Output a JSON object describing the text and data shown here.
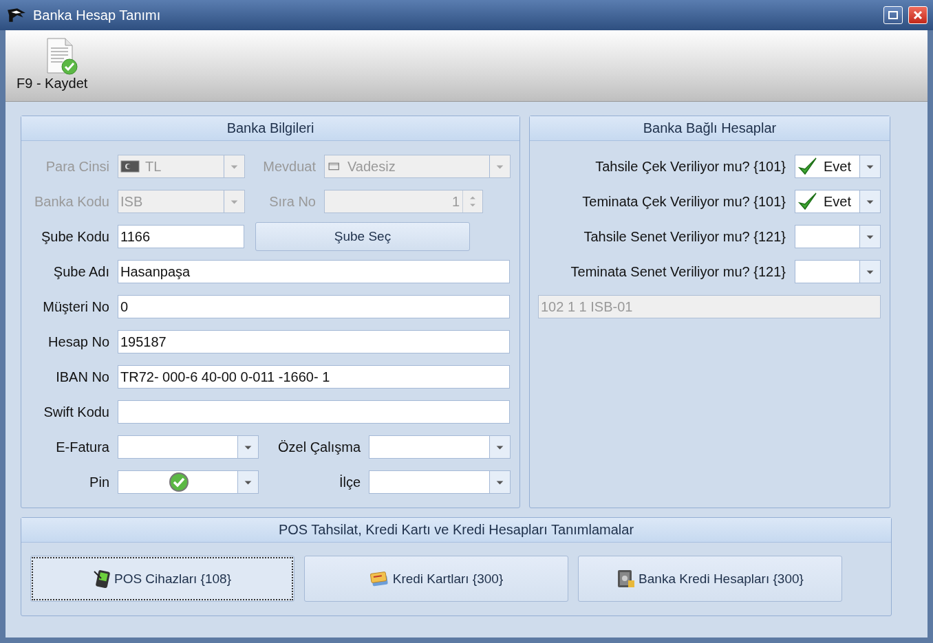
{
  "window": {
    "title": "Banka Hesap Tanımı"
  },
  "toolbar": [
    {
      "label": "F9 - Kaydet"
    }
  ],
  "bank_info": {
    "title": "Banka Bilgileri",
    "rows": [
      {
        "fields": [
          {
            "kind": "flag-combo",
            "label": "Para Cinsi",
            "value": "TL",
            "disabled": true
          },
          {
            "kind": "image-combo",
            "label": "Mevduat",
            "value": "Vadesiz",
            "disabled": true
          }
        ]
      },
      {
        "fields": [
          {
            "kind": "combo",
            "label": "Banka Kodu",
            "value": "ISB",
            "disabled": true
          },
          {
            "kind": "spin",
            "label": "Sıra No",
            "value": "1",
            "disabled": true
          }
        ]
      },
      {
        "fields": [
          {
            "kind": "text",
            "label": "Şube Kodu",
            "value": "1166",
            "disabled": false
          },
          {
            "kind": "button",
            "label": "Şube Seç"
          }
        ]
      },
      {
        "fields": [
          {
            "kind": "text",
            "label": "Şube Adı",
            "value": "Hasanpaşa",
            "disabled": false
          }
        ]
      },
      {
        "fields": [
          {
            "kind": "text",
            "label": "Müşteri No",
            "value": "0",
            "disabled": false
          }
        ]
      },
      {
        "fields": [
          {
            "kind": "text",
            "label": "Hesap No",
            "value": "195187",
            "disabled": false
          }
        ]
      },
      {
        "fields": [
          {
            "kind": "text",
            "label": "IBAN No",
            "value": "TR72- 000-6 40-00 0-011 -1660- 1",
            "disabled": false
          }
        ]
      },
      {
        "fields": [
          {
            "kind": "text",
            "label": "Swift Kodu",
            "disabled": false
          }
        ]
      },
      {
        "fields": [
          {
            "kind": "combo",
            "label": "E-Fatura",
            "disabled": false
          },
          {
            "kind": "combo",
            "label": "Özel Çalışma",
            "disabled": false
          }
        ]
      },
      {
        "fields": [
          {
            "kind": "check-combo",
            "label": "Pin",
            "checked": true,
            "disabled": false
          },
          {
            "kind": "combo",
            "label": "İlçe",
            "disabled": false
          }
        ]
      }
    ]
  },
  "linked_accounts": {
    "title": "Banka Bağlı Hesaplar",
    "rows": [
      {
        "label": "Tahsile Çek Veriliyor mu? {101}",
        "value": "Evet",
        "checked": true
      },
      {
        "label": "Teminata Çek Veriliyor mu? {101}",
        "value": "Evet",
        "checked": true
      },
      {
        "label": "Tahsile Senet Veriliyor mu? {121}",
        "checked": false
      },
      {
        "label": "Teminata Senet Veriliyor mu? {121}",
        "checked": false
      }
    ],
    "account_code": {
      "value": "102 1 1 ISB-01",
      "disabled": true
    }
  },
  "pos_section": {
    "title": "POS Tahsilat, Kredi Kartı ve Kredi Hesapları Tanımlamalar",
    "buttons": [
      {
        "kind": "pos",
        "label": "POS Cihazları {108}",
        "focused": true
      },
      {
        "kind": "cards",
        "label": "Kredi Kartları {300}",
        "focused": false
      },
      {
        "kind": "safe",
        "label": "Banka Kredi Hesapları {300}",
        "focused": false
      }
    ]
  }
}
